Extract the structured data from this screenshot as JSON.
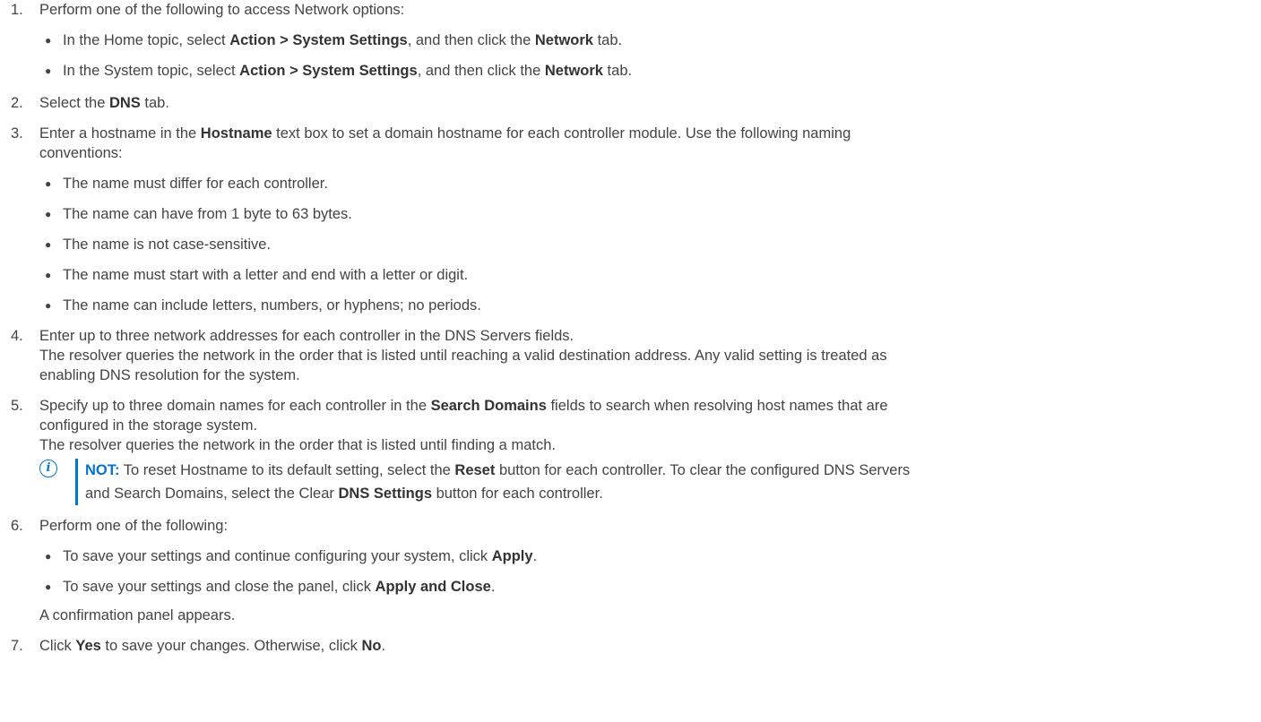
{
  "steps": [
    {
      "num": "1.",
      "lines": [
        "Perform one of the following to access Network options:"
      ],
      "bullets": [
        [
          "In the Home topic, select ",
          {
            "b": "Action > System Settings"
          },
          ", and then click the ",
          {
            "b": "Network"
          },
          " tab."
        ],
        [
          "In the System topic, select ",
          {
            "b": "Action > System Settings"
          },
          ", and then click the ",
          {
            "b": "Network"
          },
          " tab."
        ]
      ]
    },
    {
      "num": "2.",
      "lines": [
        [
          "Select the ",
          {
            "b": "DNS"
          },
          " tab."
        ]
      ]
    },
    {
      "num": "3.",
      "lines": [
        [
          "Enter a hostname in the ",
          {
            "b": "Hostname"
          },
          " text box to set a domain hostname for each controller module. Use the following naming"
        ],
        "conventions:"
      ],
      "bullets": [
        [
          "The name must differ for each controller."
        ],
        [
          "The name can have from 1 byte to 63 bytes."
        ],
        [
          "The name is not case-sensitive."
        ],
        [
          "The name must start with a letter and end with a letter or digit."
        ],
        [
          "The name can include letters, numbers, or hyphens; no periods."
        ]
      ]
    },
    {
      "num": "4.",
      "lines": [
        "Enter up to three network addresses for each controller in the DNS Servers fields.",
        "The resolver queries the network in the order that is listed until reaching a valid destination address. Any valid setting is treated as",
        "enabling DNS resolution for the system."
      ]
    },
    {
      "num": "5.",
      "lines": [
        [
          "Specify up to three domain names for each controller in the ",
          {
            "b": "Search Domains"
          },
          " fields to search when resolving host names that are"
        ],
        "configured in the storage system.",
        "The resolver queries the network in the order that is listed until finding a match."
      ],
      "note": {
        "label": "NOT:",
        "lines": [
          [
            " To reset Hostname to its default setting, select the ",
            {
              "b": "Reset"
            },
            " button for each controller. To clear the configured DNS Servers"
          ],
          [
            "and Search Domains, select the Clear ",
            {
              "b": "DNS Settings"
            },
            " button for each controller."
          ]
        ]
      }
    },
    {
      "num": "6.",
      "lines": [
        "Perform one of the following:"
      ],
      "bullets": [
        [
          "To save your settings and continue configuring your system, click ",
          {
            "b": "Apply"
          },
          "."
        ],
        [
          "To save your settings and close the panel, click ",
          {
            "b": "Apply and Close"
          },
          "."
        ]
      ],
      "after": [
        "A confirmation panel appears."
      ]
    },
    {
      "num": "7.",
      "lines": [
        [
          "Click ",
          {
            "b": "Yes"
          },
          " to save your changes. Otherwise, click ",
          {
            "b": "No"
          },
          "."
        ]
      ]
    }
  ]
}
